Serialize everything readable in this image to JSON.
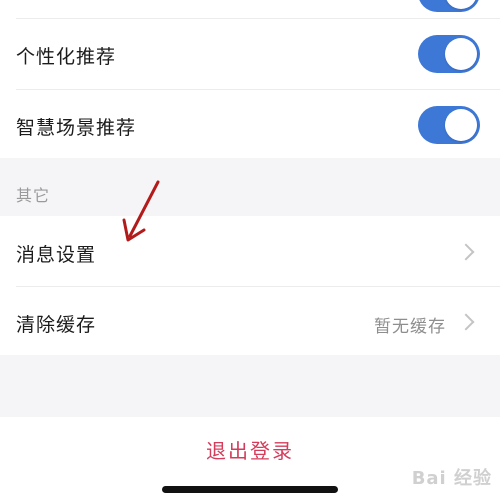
{
  "settings": {
    "toggles": [
      {
        "label": "个性化推荐",
        "on": true
      },
      {
        "label": "智慧场景推荐",
        "on": true
      }
    ],
    "other_section": {
      "title": "其它",
      "items": [
        {
          "label": "消息设置",
          "value": ""
        },
        {
          "label": "清除缓存",
          "value": "暂无缓存"
        }
      ]
    },
    "logout_label": "退出登录"
  },
  "colors": {
    "toggle_on": "#3e78d6",
    "logout": "#d43c5c",
    "annotation_arrow": "#b31b1b"
  },
  "watermark": {
    "text": "Bai 经验"
  }
}
